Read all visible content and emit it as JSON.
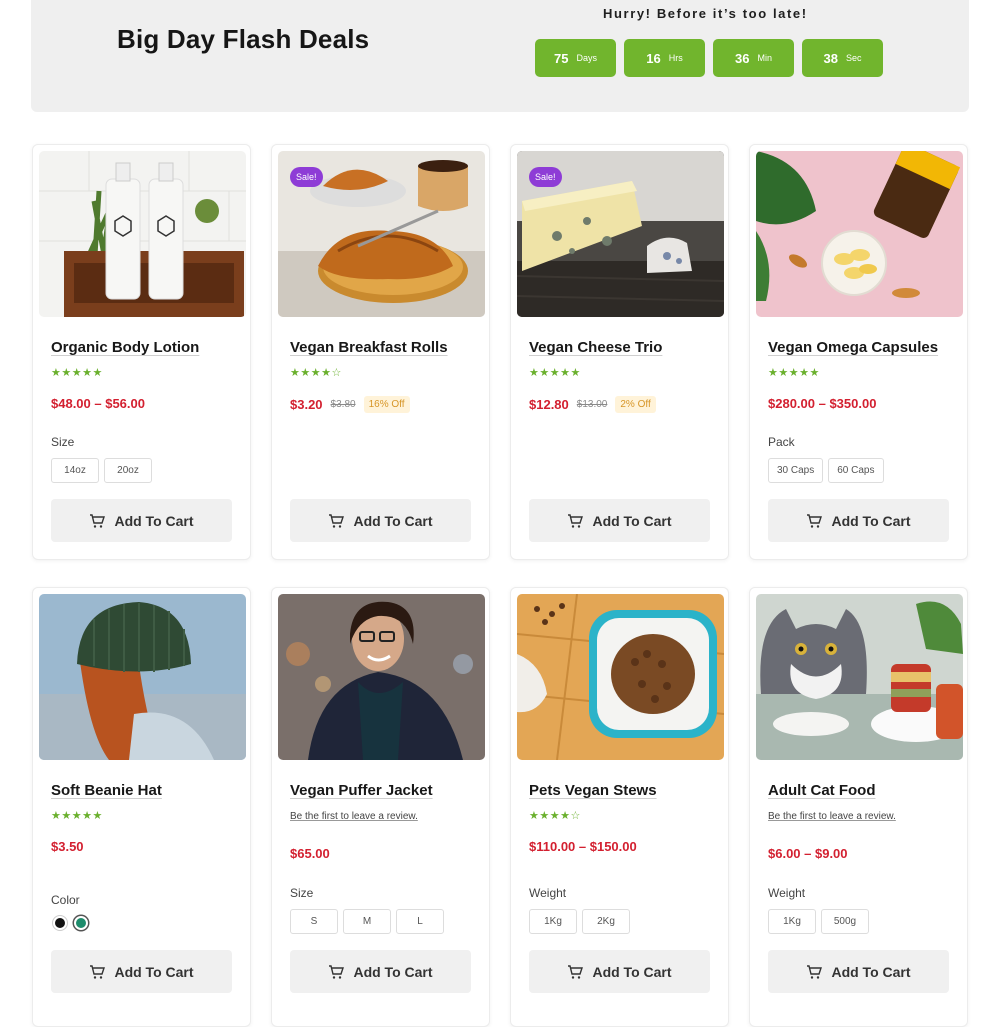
{
  "banner": {
    "title": "Big Day Flash Deals",
    "hurry": "Hurry! Before it’s too late!",
    "countdown": [
      {
        "value": "75",
        "unit": "Days"
      },
      {
        "value": "16",
        "unit": "Hrs"
      },
      {
        "value": "36",
        "unit": "Min"
      },
      {
        "value": "38",
        "unit": "Sec"
      }
    ]
  },
  "accent_color": "#71b52d",
  "cart_label": "Add To Cart",
  "products": [
    {
      "name": "Organic Body Lotion",
      "stars": "★★★★★",
      "price": "$48.00 – $56.00",
      "option_label": "Size",
      "options": [
        "14oz",
        "20oz"
      ]
    },
    {
      "name": "Vegan Breakfast Rolls",
      "badge": "Sale!",
      "stars": "★★★★☆",
      "price": "$3.20",
      "old_price": "$3.80",
      "discount": "16% Off"
    },
    {
      "name": "Vegan Cheese Trio",
      "badge": "Sale!",
      "stars": "★★★★★",
      "price": "$12.80",
      "old_price": "$13.00",
      "discount": "2% Off"
    },
    {
      "name": "Vegan Omega Capsules",
      "stars": "★★★★★",
      "price": "$280.00 – $350.00",
      "option_label": "Pack",
      "options": [
        "30 Caps",
        "60 Caps"
      ]
    },
    {
      "name": "Soft Beanie Hat",
      "stars": "★★★★★",
      "price": "$3.50",
      "option_label": "Color",
      "swatches": [
        "black",
        "teal"
      ]
    },
    {
      "name": "Vegan Puffer Jacket",
      "review": "Be the first to leave a review.",
      "price": "$65.00",
      "option_label": "Size",
      "options": [
        "S",
        "M",
        "L"
      ]
    },
    {
      "name": "Pets Vegan Stews",
      "stars": "★★★★☆",
      "price": "$110.00 – $150.00",
      "option_label": "Weight",
      "options": [
        "1Kg",
        "2Kg"
      ]
    },
    {
      "name": "Adult Cat Food",
      "review": "Be the first to leave a review.",
      "price": "$6.00 – $9.00",
      "option_label": "Weight",
      "options": [
        "1Kg",
        "500g"
      ]
    }
  ]
}
